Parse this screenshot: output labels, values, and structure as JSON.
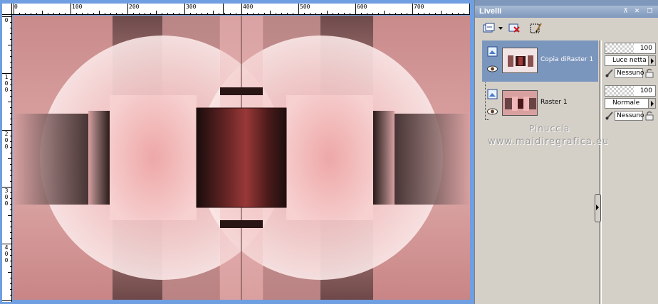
{
  "ruler": {
    "top_labels": [
      "0",
      "100",
      "200",
      "300",
      "400",
      "500",
      "600",
      "700"
    ],
    "left_labels": [
      [
        "0"
      ],
      [
        "1",
        "0",
        "0"
      ],
      [
        "2",
        "0",
        "0"
      ],
      [
        "3",
        "0",
        "0"
      ],
      [
        "4",
        "0",
        "0"
      ]
    ]
  },
  "layers_panel": {
    "title": "Livelli",
    "layers": [
      {
        "name": "Copia diRaster 1",
        "selected": true,
        "opacity": "100",
        "blend_mode": "Luce netta",
        "group": "Nessuno"
      },
      {
        "name": "Raster 1",
        "selected": false,
        "opacity": "100",
        "blend_mode": "Normale",
        "group": "Nessuno"
      }
    ],
    "toolbar_icons": [
      "new-layer-icon",
      "dropdown-arrow-icon",
      "delete-layer-icon",
      "edit-selection-icon"
    ]
  },
  "watermark": {
    "line1": "Pinuccia",
    "line2": "www.maidiregrafica.eu"
  },
  "colors": {
    "titlebar": "#7e97bb",
    "selected_row": "#7b96bd",
    "canvas_border": "#6f9fe0",
    "panel_bg": "#d4d0c8"
  }
}
